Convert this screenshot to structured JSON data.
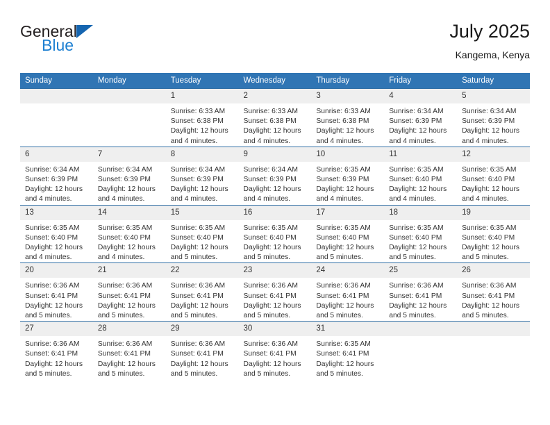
{
  "brand": {
    "name_part1": "General",
    "name_part2": "Blue",
    "logo_icon": "triangle-flag-icon"
  },
  "header": {
    "title": "July 2025",
    "location": "Kangema, Kenya"
  },
  "colors": {
    "header_blue": "#3075b4",
    "brand_blue": "#1c7fd1",
    "row_divider": "#2e6da4",
    "daynum_band": "#efefef"
  },
  "weekday_headers": [
    "Sunday",
    "Monday",
    "Tuesday",
    "Wednesday",
    "Thursday",
    "Friday",
    "Saturday"
  ],
  "weeks": [
    [
      {
        "day": "",
        "empty": true,
        "lines": []
      },
      {
        "day": "",
        "empty": true,
        "lines": []
      },
      {
        "day": "1",
        "lines": [
          "Sunrise: 6:33 AM",
          "Sunset: 6:38 PM",
          "Daylight: 12 hours",
          "and 4 minutes."
        ]
      },
      {
        "day": "2",
        "lines": [
          "Sunrise: 6:33 AM",
          "Sunset: 6:38 PM",
          "Daylight: 12 hours",
          "and 4 minutes."
        ]
      },
      {
        "day": "3",
        "lines": [
          "Sunrise: 6:33 AM",
          "Sunset: 6:38 PM",
          "Daylight: 12 hours",
          "and 4 minutes."
        ]
      },
      {
        "day": "4",
        "lines": [
          "Sunrise: 6:34 AM",
          "Sunset: 6:39 PM",
          "Daylight: 12 hours",
          "and 4 minutes."
        ]
      },
      {
        "day": "5",
        "lines": [
          "Sunrise: 6:34 AM",
          "Sunset: 6:39 PM",
          "Daylight: 12 hours",
          "and 4 minutes."
        ]
      }
    ],
    [
      {
        "day": "6",
        "lines": [
          "Sunrise: 6:34 AM",
          "Sunset: 6:39 PM",
          "Daylight: 12 hours",
          "and 4 minutes."
        ]
      },
      {
        "day": "7",
        "lines": [
          "Sunrise: 6:34 AM",
          "Sunset: 6:39 PM",
          "Daylight: 12 hours",
          "and 4 minutes."
        ]
      },
      {
        "day": "8",
        "lines": [
          "Sunrise: 6:34 AM",
          "Sunset: 6:39 PM",
          "Daylight: 12 hours",
          "and 4 minutes."
        ]
      },
      {
        "day": "9",
        "lines": [
          "Sunrise: 6:34 AM",
          "Sunset: 6:39 PM",
          "Daylight: 12 hours",
          "and 4 minutes."
        ]
      },
      {
        "day": "10",
        "lines": [
          "Sunrise: 6:35 AM",
          "Sunset: 6:39 PM",
          "Daylight: 12 hours",
          "and 4 minutes."
        ]
      },
      {
        "day": "11",
        "lines": [
          "Sunrise: 6:35 AM",
          "Sunset: 6:40 PM",
          "Daylight: 12 hours",
          "and 4 minutes."
        ]
      },
      {
        "day": "12",
        "lines": [
          "Sunrise: 6:35 AM",
          "Sunset: 6:40 PM",
          "Daylight: 12 hours",
          "and 4 minutes."
        ]
      }
    ],
    [
      {
        "day": "13",
        "lines": [
          "Sunrise: 6:35 AM",
          "Sunset: 6:40 PM",
          "Daylight: 12 hours",
          "and 4 minutes."
        ]
      },
      {
        "day": "14",
        "lines": [
          "Sunrise: 6:35 AM",
          "Sunset: 6:40 PM",
          "Daylight: 12 hours",
          "and 4 minutes."
        ]
      },
      {
        "day": "15",
        "lines": [
          "Sunrise: 6:35 AM",
          "Sunset: 6:40 PM",
          "Daylight: 12 hours",
          "and 5 minutes."
        ]
      },
      {
        "day": "16",
        "lines": [
          "Sunrise: 6:35 AM",
          "Sunset: 6:40 PM",
          "Daylight: 12 hours",
          "and 5 minutes."
        ]
      },
      {
        "day": "17",
        "lines": [
          "Sunrise: 6:35 AM",
          "Sunset: 6:40 PM",
          "Daylight: 12 hours",
          "and 5 minutes."
        ]
      },
      {
        "day": "18",
        "lines": [
          "Sunrise: 6:35 AM",
          "Sunset: 6:40 PM",
          "Daylight: 12 hours",
          "and 5 minutes."
        ]
      },
      {
        "day": "19",
        "lines": [
          "Sunrise: 6:35 AM",
          "Sunset: 6:40 PM",
          "Daylight: 12 hours",
          "and 5 minutes."
        ]
      }
    ],
    [
      {
        "day": "20",
        "lines": [
          "Sunrise: 6:36 AM",
          "Sunset: 6:41 PM",
          "Daylight: 12 hours",
          "and 5 minutes."
        ]
      },
      {
        "day": "21",
        "lines": [
          "Sunrise: 6:36 AM",
          "Sunset: 6:41 PM",
          "Daylight: 12 hours",
          "and 5 minutes."
        ]
      },
      {
        "day": "22",
        "lines": [
          "Sunrise: 6:36 AM",
          "Sunset: 6:41 PM",
          "Daylight: 12 hours",
          "and 5 minutes."
        ]
      },
      {
        "day": "23",
        "lines": [
          "Sunrise: 6:36 AM",
          "Sunset: 6:41 PM",
          "Daylight: 12 hours",
          "and 5 minutes."
        ]
      },
      {
        "day": "24",
        "lines": [
          "Sunrise: 6:36 AM",
          "Sunset: 6:41 PM",
          "Daylight: 12 hours",
          "and 5 minutes."
        ]
      },
      {
        "day": "25",
        "lines": [
          "Sunrise: 6:36 AM",
          "Sunset: 6:41 PM",
          "Daylight: 12 hours",
          "and 5 minutes."
        ]
      },
      {
        "day": "26",
        "lines": [
          "Sunrise: 6:36 AM",
          "Sunset: 6:41 PM",
          "Daylight: 12 hours",
          "and 5 minutes."
        ]
      }
    ],
    [
      {
        "day": "27",
        "lines": [
          "Sunrise: 6:36 AM",
          "Sunset: 6:41 PM",
          "Daylight: 12 hours",
          "and 5 minutes."
        ]
      },
      {
        "day": "28",
        "lines": [
          "Sunrise: 6:36 AM",
          "Sunset: 6:41 PM",
          "Daylight: 12 hours",
          "and 5 minutes."
        ]
      },
      {
        "day": "29",
        "lines": [
          "Sunrise: 6:36 AM",
          "Sunset: 6:41 PM",
          "Daylight: 12 hours",
          "and 5 minutes."
        ]
      },
      {
        "day": "30",
        "lines": [
          "Sunrise: 6:36 AM",
          "Sunset: 6:41 PM",
          "Daylight: 12 hours",
          "and 5 minutes."
        ]
      },
      {
        "day": "31",
        "lines": [
          "Sunrise: 6:35 AM",
          "Sunset: 6:41 PM",
          "Daylight: 12 hours",
          "and 5 minutes."
        ]
      },
      {
        "day": "",
        "empty": true,
        "lines": []
      },
      {
        "day": "",
        "empty": true,
        "lines": []
      }
    ]
  ]
}
